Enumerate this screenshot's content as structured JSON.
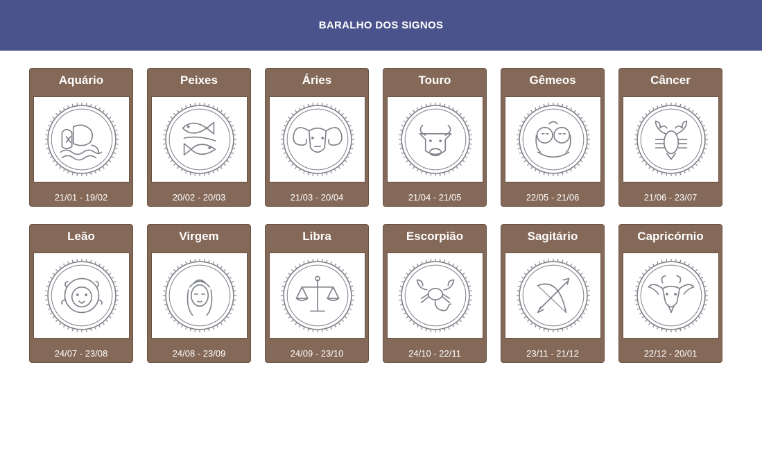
{
  "header": {
    "title": "BARALHO DOS SIGNOS"
  },
  "signs": [
    {
      "name": "Aquário",
      "dates": "21/01 - 19/02",
      "icon": "aquarius-icon"
    },
    {
      "name": "Peixes",
      "dates": "20/02 - 20/03",
      "icon": "pisces-icon"
    },
    {
      "name": "Áries",
      "dates": "21/03 - 20/04",
      "icon": "aries-icon"
    },
    {
      "name": "Touro",
      "dates": "21/04 - 21/05",
      "icon": "taurus-icon"
    },
    {
      "name": "Gêmeos",
      "dates": "22/05 - 21/06",
      "icon": "gemini-icon"
    },
    {
      "name": "Câncer",
      "dates": "21/06 - 23/07",
      "icon": "cancer-icon"
    },
    {
      "name": "Leão",
      "dates": "24/07 - 23/08",
      "icon": "leo-icon"
    },
    {
      "name": "Virgem",
      "dates": "24/08 - 23/09",
      "icon": "virgo-icon"
    },
    {
      "name": "Libra",
      "dates": "24/09 - 23/10",
      "icon": "libra-icon"
    },
    {
      "name": "Escorpião",
      "dates": "24/10 - 22/11",
      "icon": "scorpio-icon"
    },
    {
      "name": "Sagitário",
      "dates": "23/11 - 21/12",
      "icon": "sagittarius-icon"
    },
    {
      "name": "Capricórnio",
      "dates": "22/12 - 20/01",
      "icon": "capricorn-icon"
    }
  ],
  "colors": {
    "header_bg": "#4b538c",
    "card_bg": "#846858",
    "icon_stroke": "#7d8088"
  }
}
